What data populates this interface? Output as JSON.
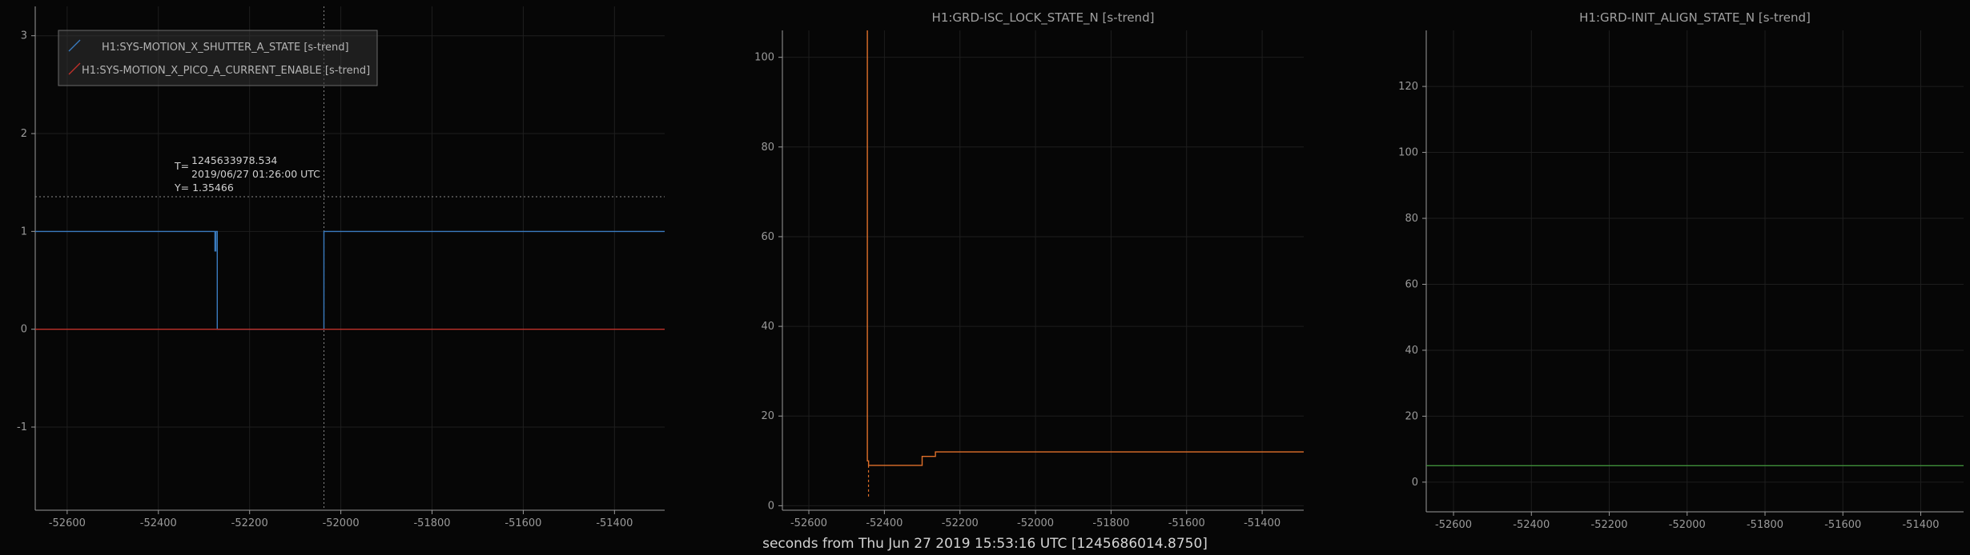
{
  "colors": {
    "background": "#060606",
    "axis": "#9a9a9a",
    "grid": "#1e1e1e",
    "shutter": "#3a7bbf",
    "pico": "#c0312a",
    "isc": "#e0702a",
    "init": "#3f8f3a"
  },
  "xlabel": "seconds from Thu Jun 27 2019 15:53:16 UTC [1245686014.8750]",
  "chart_data": [
    {
      "type": "line",
      "title": "",
      "xlim": [
        -52670,
        -51290
      ],
      "ylim": [
        -1.85,
        3.3
      ],
      "xticks": [
        -52600,
        -52400,
        -52200,
        -52000,
        -51800,
        -51600,
        -51400
      ],
      "xtick_labels": [
        "-52600",
        "-52400",
        "-52200",
        "-52000",
        "-51800",
        "-51600",
        "-51400"
      ],
      "yticks": [
        -1,
        0,
        1,
        2,
        3
      ],
      "ytick_labels": [
        "-1",
        "0",
        "1",
        "2",
        "3"
      ],
      "legend": {
        "placement": "top-left",
        "entries": [
          "H1:SYS-MOTION_X_SHUTTER_A_STATE [s-trend]",
          "H1:SYS-MOTION_X_PICO_A_CURRENT_ENABLE [s-trend]"
        ]
      },
      "series": [
        {
          "name": "H1:SYS-MOTION_X_SHUTTER_A_STATE [s-trend]",
          "color_key": "shutter",
          "x": [
            -52670,
            -52276,
            -52276,
            -52274,
            -52274,
            -52271,
            -52271,
            -52037,
            -52037,
            -51290
          ],
          "y": [
            1,
            1,
            0.8,
            0.8,
            1,
            1,
            0,
            0,
            1,
            1
          ]
        },
        {
          "name": "H1:SYS-MOTION_X_PICO_A_CURRENT_ENABLE [s-trend]",
          "color_key": "pico",
          "x": [
            -52670,
            -51290
          ],
          "y": [
            0,
            0
          ]
        }
      ],
      "cursor": {
        "x": -52037,
        "y": 1.35466
      },
      "annotation": {
        "t_label": "T=",
        "t_value": "1245633978.534",
        "t_date": "2019/06/27 01:26:00 UTC",
        "y_text": "Y= 1.35466"
      }
    },
    {
      "type": "line",
      "title": "H1:GRD-ISC_LOCK_STATE_N [s-trend]",
      "xlim": [
        -52670,
        -51290
      ],
      "ylim": [
        -1,
        106
      ],
      "xticks": [
        -52600,
        -52400,
        -52200,
        -52000,
        -51800,
        -51600,
        -51400
      ],
      "xtick_labels": [
        "-52600",
        "-52400",
        "-52200",
        "-52000",
        "-51800",
        "-51600",
        "-51400"
      ],
      "yticks": [
        0,
        20,
        40,
        60,
        80,
        100
      ],
      "ytick_labels": [
        "0",
        "20",
        "40",
        "60",
        "80",
        "100"
      ],
      "series": [
        {
          "color_key": "isc",
          "x": [
            -52445,
            -52445,
            -52442,
            -52442,
            -52300,
            -52300,
            -52265,
            -52265,
            -51290
          ],
          "y": [
            106,
            10,
            10,
            9,
            9,
            11,
            11,
            12,
            12
          ]
        }
      ],
      "dashed": {
        "x": -52442,
        "y0": 9,
        "y1": 2
      }
    },
    {
      "type": "line",
      "title": "H1:GRD-INIT_ALIGN_STATE_N [s-trend]",
      "xlim": [
        -52670,
        -51290
      ],
      "ylim": [
        -9,
        137
      ],
      "xticks": [
        -52600,
        -52400,
        -52200,
        -52000,
        -51800,
        -51600,
        -51400
      ],
      "xtick_labels": [
        "-52600",
        "-52400",
        "-52200",
        "-52000",
        "-51800",
        "-51600",
        "-51400"
      ],
      "yticks": [
        0,
        20,
        40,
        60,
        80,
        100,
        120
      ],
      "ytick_labels": [
        "0",
        "20",
        "40",
        "60",
        "80",
        "100",
        "120"
      ],
      "series": [
        {
          "color_key": "init",
          "x": [
            -52670,
            -51290
          ],
          "y": [
            5,
            5
          ]
        }
      ]
    }
  ]
}
